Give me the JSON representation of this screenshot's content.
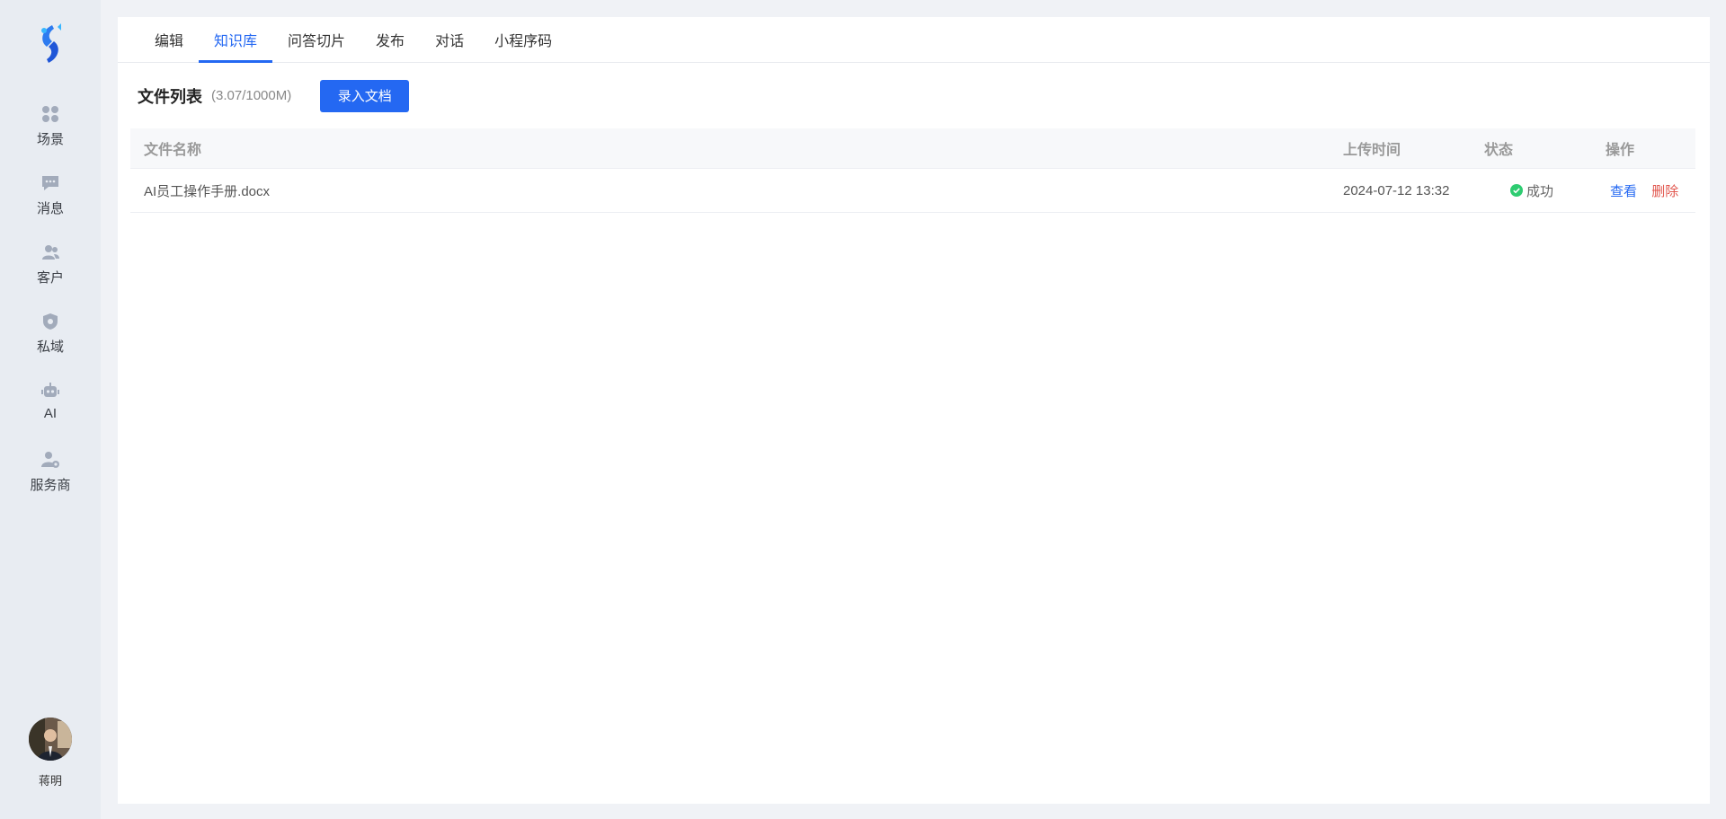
{
  "sidebar": {
    "nav": [
      {
        "label": "场景",
        "icon": "grid-dots-icon"
      },
      {
        "label": "消息",
        "icon": "chat-bubble-icon"
      },
      {
        "label": "客户",
        "icon": "users-icon"
      },
      {
        "label": "私域",
        "icon": "shield-icon"
      },
      {
        "label": "AI",
        "icon": "robot-icon"
      },
      {
        "label": "服务商",
        "icon": "user-gear-icon"
      }
    ],
    "user": {
      "name": "蒋明"
    }
  },
  "tabs": [
    {
      "label": "编辑",
      "active": false
    },
    {
      "label": "知识库",
      "active": true
    },
    {
      "label": "问答切片",
      "active": false
    },
    {
      "label": "发布",
      "active": false
    },
    {
      "label": "对话",
      "active": false
    },
    {
      "label": "小程序码",
      "active": false
    }
  ],
  "toolbar": {
    "title": "文件列表",
    "quota": "(3.07/1000M)",
    "upload_label": "录入文档"
  },
  "table": {
    "columns": {
      "name": "文件名称",
      "time": "上传时间",
      "status": "状态",
      "ops": "操作"
    },
    "rows": [
      {
        "name": "AI员工操作手册.docx",
        "time": "2024-07-12 13:32",
        "status": "成功",
        "view": "查看",
        "delete": "删除"
      }
    ]
  },
  "colors": {
    "accent": "#2468f2",
    "danger": "#e1554c",
    "success": "#2ecc71",
    "icon": "#a2abbb"
  }
}
